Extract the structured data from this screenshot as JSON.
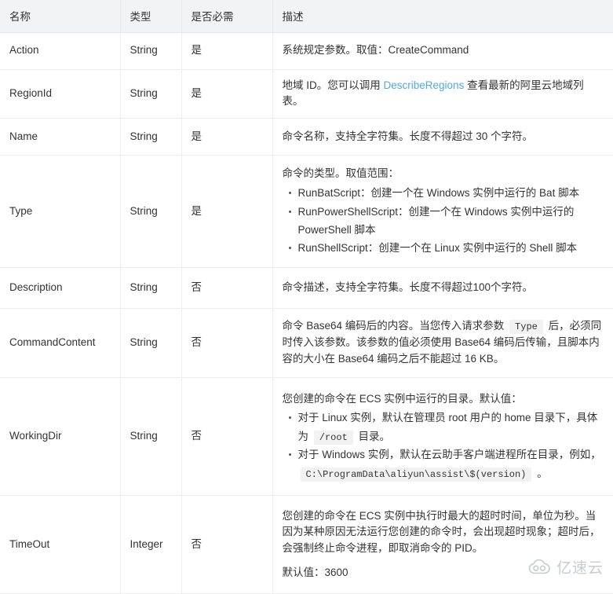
{
  "table": {
    "headers": [
      "名称",
      "类型",
      "是否必需",
      "描述"
    ],
    "colors": {
      "header_bg": "#f2f3f5",
      "border": "#ededed",
      "link": "#4ea9dd",
      "code_bg": "#f2f2f2",
      "text": "#333333"
    },
    "rows": [
      {
        "name": "Action",
        "type": "String",
        "required": "是",
        "desc": {
          "lead": "系统规定参数。取值：CreateCommand"
        }
      },
      {
        "name": "RegionId",
        "type": "String",
        "required": "是",
        "desc": {
          "pre": "地域 ID。您可以调用 ",
          "link": "DescribeRegions",
          "post": " 查看最新的阿里云地域列表。"
        }
      },
      {
        "name": "Name",
        "type": "String",
        "required": "是",
        "desc": {
          "lead": "命令名称，支持全字符集。长度不得超过 30 个字符。"
        }
      },
      {
        "name": "Type",
        "type": "String",
        "required": "是",
        "desc": {
          "lead": "命令的类型。取值范围：",
          "bullets": [
            "RunBatScript：创建一个在 Windows 实例中运行的 Bat 脚本",
            "RunPowerShellScript：创建一个在 Windows 实例中运行的 PowerShell 脚本",
            "RunShellScript：创建一个在 Linux 实例中运行的 Shell 脚本"
          ]
        }
      },
      {
        "name": "Description",
        "type": "String",
        "required": "否",
        "desc": {
          "lead": "命令描述，支持全字符集。长度不得超过100个字符。"
        }
      },
      {
        "name": "CommandContent",
        "type": "String",
        "required": "否",
        "desc": {
          "pre": "命令 Base64 编码后的内容。当您传入请求参数 ",
          "code": "Type",
          "post": " 后，必须同时传入该参数。该参数的值必须使用 Base64 编码后传输，且脚本内容的大小在 Base64 编码之后不能超过 16 KB。"
        }
      },
      {
        "name": "WorkingDir",
        "type": "String",
        "required": "否",
        "desc": {
          "lead": "您创建的命令在 ECS 实例中运行的目录。默认值：",
          "bullets_rich": [
            {
              "pre": "对于 Linux 实例，默认在管理员 root 用户的 home 目录下，具体为 ",
              "code": "/root",
              "post": " 目录。"
            },
            {
              "pre": "对于 Windows 实例，默认在云助手客户端进程所在目录，例如， ",
              "code": "C:\\ProgramData\\aliyun\\assist\\$(version)",
              "post": " 。"
            }
          ]
        }
      },
      {
        "name": "TimeOut",
        "type": "Integer",
        "required": "否",
        "desc": {
          "lead": "您创建的命令在 ECS 实例中执行时最大的超时时间，单位为秒。当因为某种原因无法运行您创建的命令时，会出现超时现象；超时后，会强制终止命令进程，即取消命令的 PID。",
          "second": "默认值：3600"
        }
      }
    ]
  },
  "watermark": {
    "text": "亿速云",
    "icon": "cloud-icon"
  }
}
